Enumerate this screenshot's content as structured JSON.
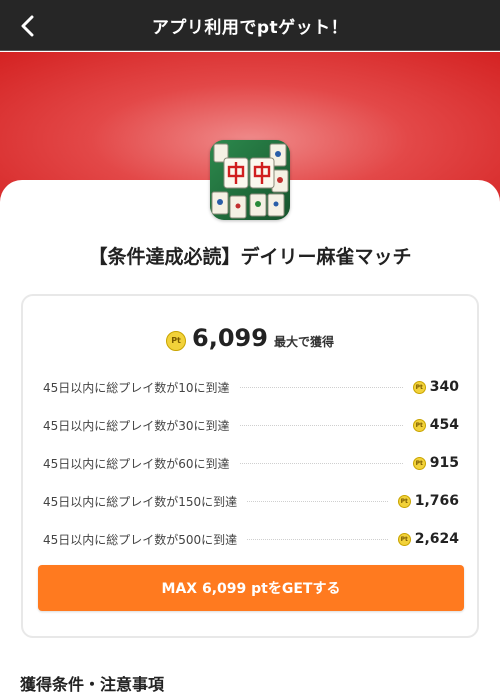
{
  "header": {
    "title": "アプリ利用でptゲット！",
    "back_icon": "chevron-left-icon"
  },
  "app": {
    "icon": "mahjong-app-icon",
    "title": "【条件達成必読】デイリー麻雀マッチ"
  },
  "reward": {
    "badge": "Pt",
    "total_amount": "6,099",
    "total_label": "最大で獲得",
    "rows": [
      {
        "label": "45日以内に総プレイ数が10に到達",
        "points": "340"
      },
      {
        "label": "45日以内に総プレイ数が30に到達",
        "points": "454"
      },
      {
        "label": "45日以内に総プレイ数が60に到達",
        "points": "915"
      },
      {
        "label": "45日以内に総プレイ数が150に到達",
        "points": "1,766"
      },
      {
        "label": "45日以内に総プレイ数が500に到達",
        "points": "2,624"
      }
    ],
    "cta_label": "MAX 6,099 ptをGETする"
  },
  "conditions": {
    "heading": "獲得条件・注意事項"
  },
  "colors": {
    "header_bg": "#262626",
    "hero_red": "#d42222",
    "cta_orange": "#ff7a1f",
    "pt_gold": "#f2d23a"
  }
}
